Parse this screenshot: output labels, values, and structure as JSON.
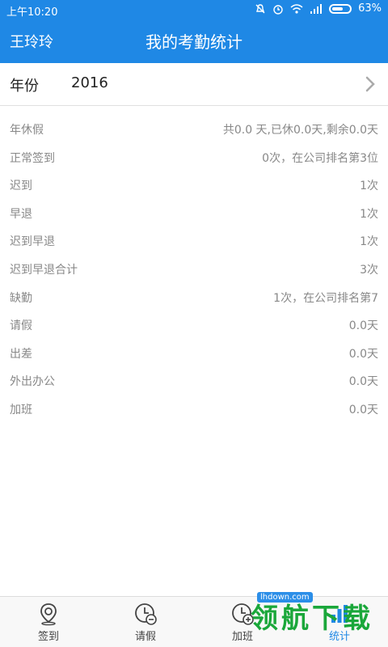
{
  "status_bar": {
    "time": "上午10:20",
    "battery": "63%",
    "battery_level": 0.63
  },
  "header": {
    "user": "王玲玲",
    "title": "我的考勤统计"
  },
  "year_selector": {
    "label": "年份",
    "value": "2016"
  },
  "stats": [
    {
      "label": "年休假",
      "value": "共0.0 天,已休0.0天,剩余0.0天"
    },
    {
      "label": "正常签到",
      "value": "0次，在公司排名第3位"
    },
    {
      "label": "迟到",
      "value": "1次"
    },
    {
      "label": "早退",
      "value": "1次"
    },
    {
      "label": "迟到早退",
      "value": "1次"
    },
    {
      "label": "迟到早退合计",
      "value": "3次"
    },
    {
      "label": "缺勤",
      "value": "1次，在公司排名第7"
    },
    {
      "label": "请假",
      "value": "0.0天"
    },
    {
      "label": "出差",
      "value": "0.0天"
    },
    {
      "label": "外出办公",
      "value": "0.0天"
    },
    {
      "label": "加班",
      "value": "0.0天"
    }
  ],
  "bottom_nav": [
    {
      "label": "签到",
      "icon": "location-pin-icon"
    },
    {
      "label": "请假",
      "icon": "clock-minus-icon"
    },
    {
      "label": "加班",
      "icon": "clock-plus-icon"
    },
    {
      "label": "统计",
      "icon": "stats-icon"
    }
  ],
  "watermark": {
    "badge": "lhdown.com",
    "text": "领航下载"
  },
  "colors": {
    "primary": "#1f88e5",
    "text_secondary": "#888888",
    "watermark": "#1aa73a"
  }
}
